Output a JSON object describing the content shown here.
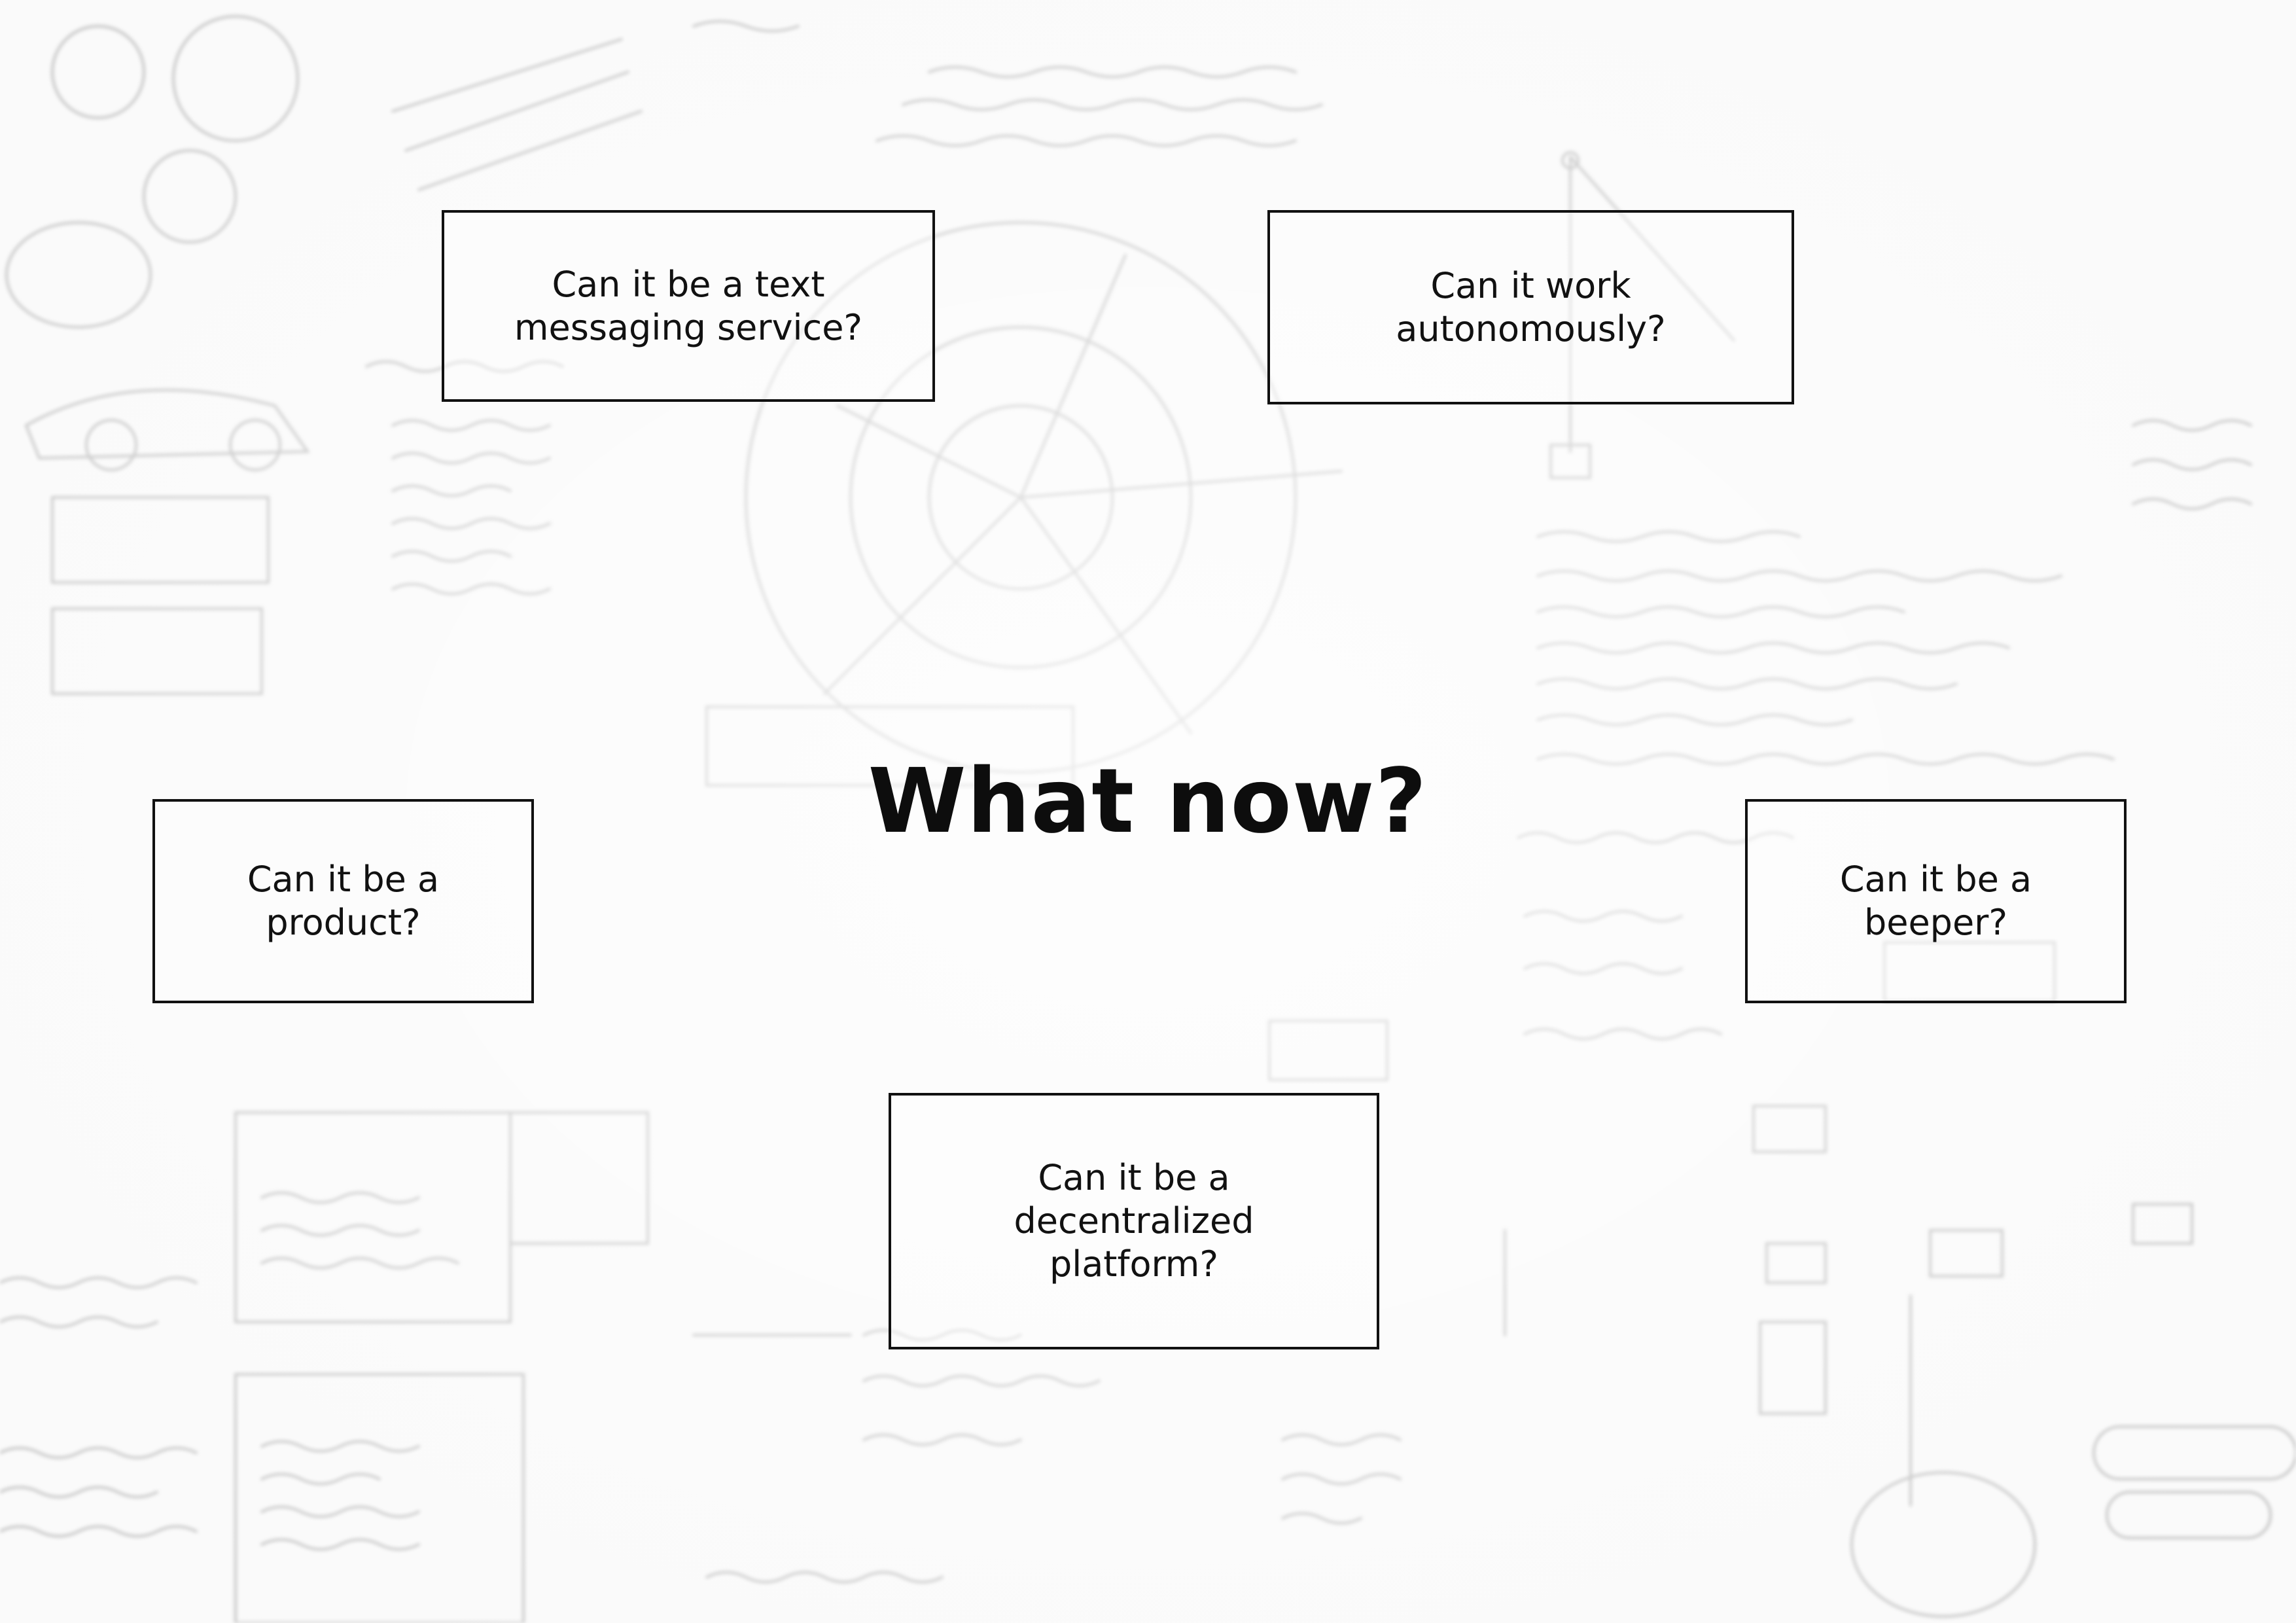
{
  "title": "What now?",
  "questions": {
    "text_messaging": "Can it be a text\nmessaging service?",
    "autonomous": "Can it work\nautonomously?",
    "product": "Can it be a\nproduct?",
    "beeper": "Can it be a\nbeeper?",
    "decentralized": "Can it be a\ndecentralized\nplatform?"
  },
  "colors": {
    "text": "#111111",
    "border": "#111111",
    "background": "#f9f9f9",
    "sketch": "#8a8a8a"
  }
}
